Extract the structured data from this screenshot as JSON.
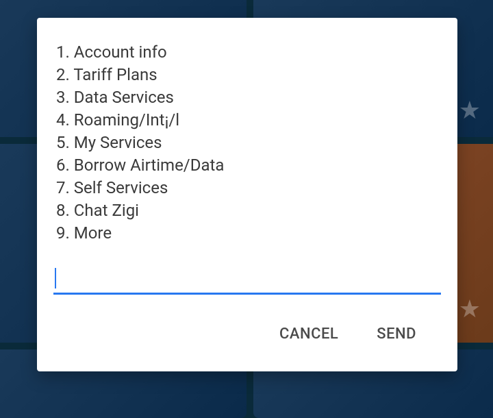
{
  "menu": {
    "items": [
      {
        "num": "1.",
        "label": "Account info"
      },
      {
        "num": "2.",
        "label": "Tariff Plans"
      },
      {
        "num": "3.",
        "label": "Data Services"
      },
      {
        "num": "4.",
        "label": "Roaming/Int¡/l"
      },
      {
        "num": "5.",
        "label": "My Services"
      },
      {
        "num": "6.",
        "label": "Borrow Airtime/Data"
      },
      {
        "num": "7.",
        "label": "Self Services"
      },
      {
        "num": "8.",
        "label": "Chat Zigi"
      },
      {
        "num": "9.",
        "label": "More"
      }
    ]
  },
  "input": {
    "value": "",
    "placeholder": ""
  },
  "buttons": {
    "cancel": "CANCEL",
    "send": "SEND"
  }
}
